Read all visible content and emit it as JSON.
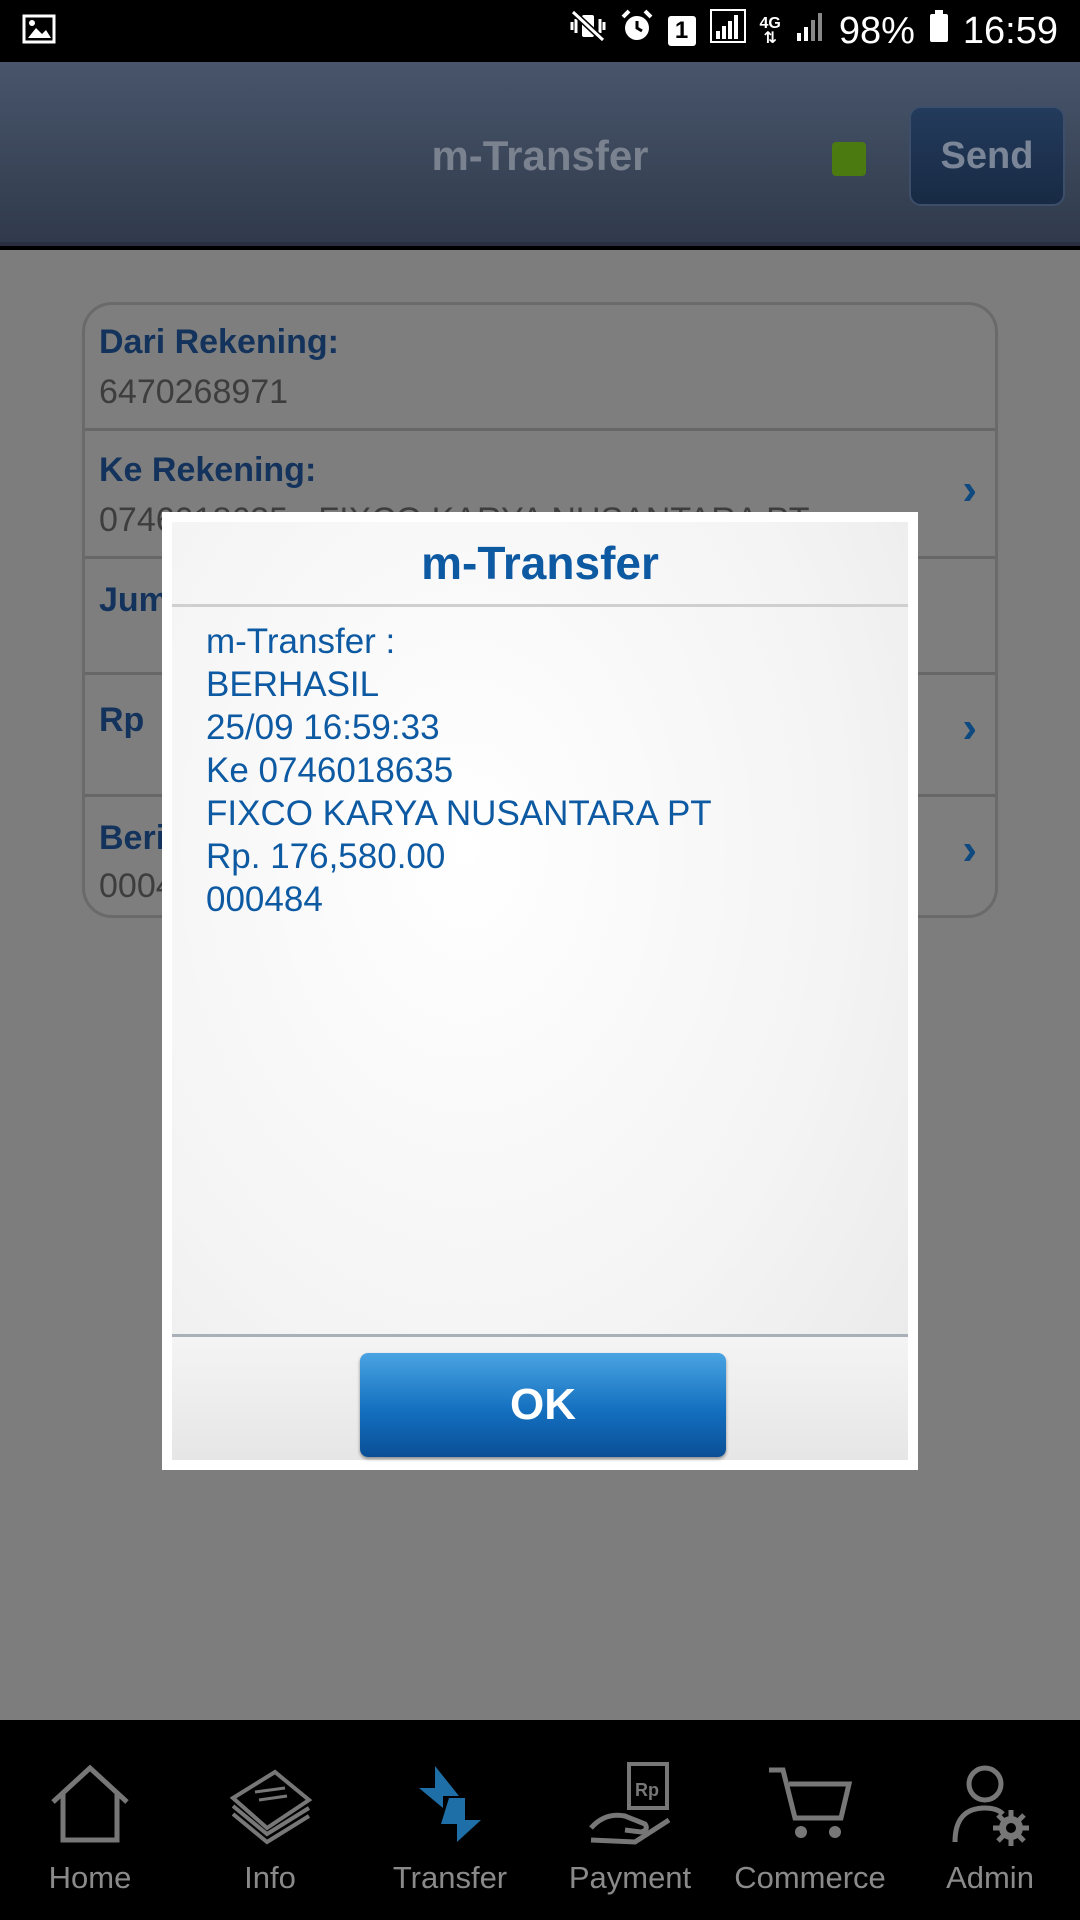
{
  "status_bar": {
    "battery": "98%",
    "time": "16:59",
    "sim_slot": "1",
    "network": "4G"
  },
  "header": {
    "title": "m-Transfer",
    "send_label": "Send",
    "status_color": "#4a7a10"
  },
  "form": {
    "from_account": {
      "label": "Dari Rekening:",
      "value": "6470268971"
    },
    "to_account": {
      "label": "Ke Rekening:",
      "value": "0746018635 - FIXCO KARYA NUSANTARA PT"
    },
    "amount": {
      "label": "Jumlah"
    },
    "currency": {
      "label": "Rp"
    },
    "news": {
      "label": "Berita",
      "value": "000484"
    }
  },
  "dialog": {
    "title": "m-Transfer",
    "lines": [
      "m-Transfer :",
      "BERHASIL",
      "25/09 16:59:33",
      "Ke 0746018635",
      "FIXCO KARYA NUSANTARA PT",
      "Rp. 176,580.00",
      "000484"
    ],
    "ok_label": "OK"
  },
  "bottom_nav": [
    {
      "label": "Home",
      "icon": "home-icon"
    },
    {
      "label": "Info",
      "icon": "info-icon"
    },
    {
      "label": "Transfer",
      "icon": "transfer-icon",
      "active": true
    },
    {
      "label": "Payment",
      "icon": "payment-icon"
    },
    {
      "label": "Commerce",
      "icon": "cart-icon"
    },
    {
      "label": "Admin",
      "icon": "admin-icon"
    }
  ],
  "colors": {
    "accent": "#0d5aa3",
    "header_bg": "#3a4558",
    "active_nav": "#1e6fa8"
  }
}
